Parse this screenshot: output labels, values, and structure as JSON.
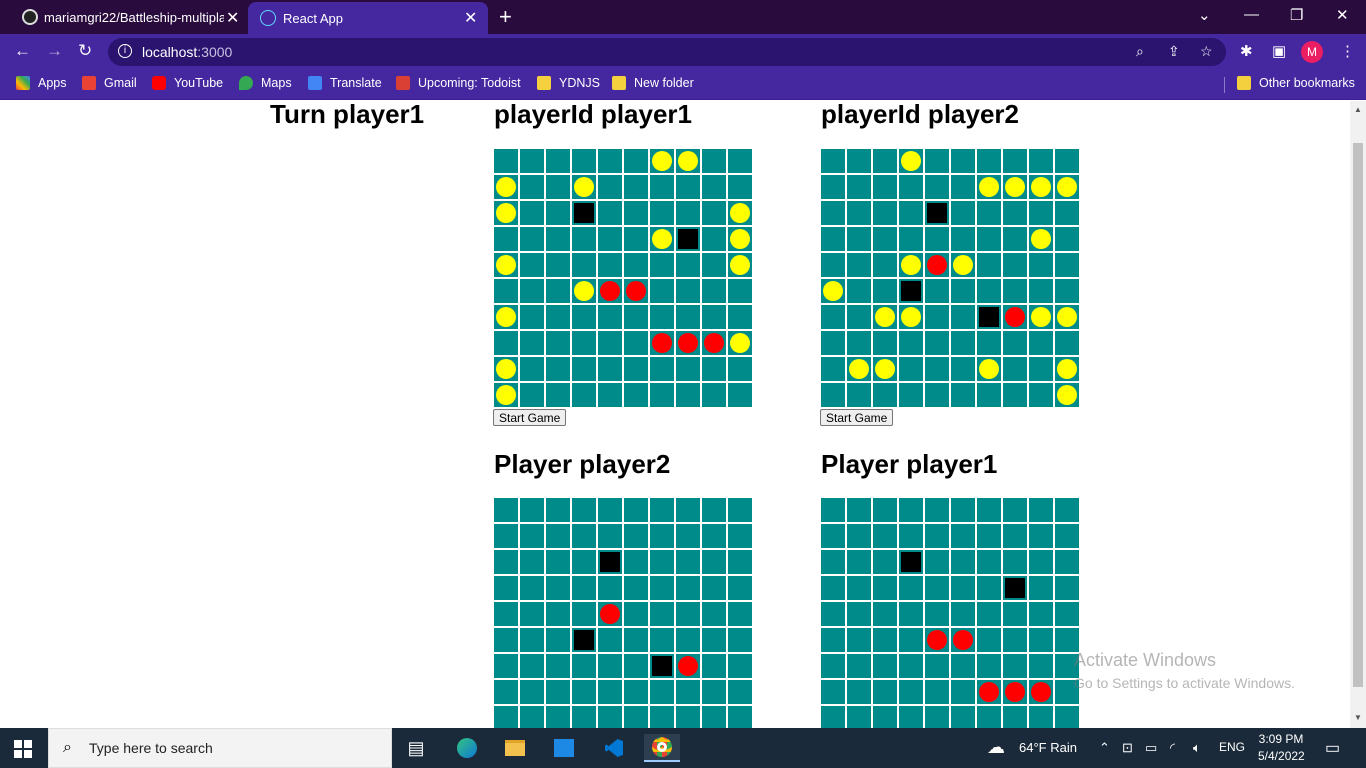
{
  "browser": {
    "tabs": [
      {
        "title": "mariamgri22/Battleship-multipla",
        "favicon": "github-icon"
      },
      {
        "title": "React App",
        "favicon": "react-icon"
      }
    ],
    "url_host": "localhost",
    "url_port": ":3000",
    "profile_initial": "M",
    "bookmarks": [
      {
        "label": "Apps",
        "icon": "apps-grid-icon"
      },
      {
        "label": "Gmail",
        "icon": "gmail-icon"
      },
      {
        "label": "YouTube",
        "icon": "youtube-icon"
      },
      {
        "label": "Maps",
        "icon": "maps-icon"
      },
      {
        "label": "Translate",
        "icon": "translate-icon"
      },
      {
        "label": "Upcoming: Todoist",
        "icon": "todoist-icon"
      },
      {
        "label": "YDNJS",
        "icon": "folder-icon"
      },
      {
        "label": "New folder",
        "icon": "folder-icon"
      }
    ],
    "other_bookmarks": "Other bookmarks"
  },
  "page": {
    "turn_label": "Turn player1",
    "board1_title": "playerId player1",
    "board2_title": "playerId player2",
    "board3_title": "Player player2",
    "board4_title": "Player player1",
    "start_button": "Start Game",
    "colors": {
      "water": "#008b8b",
      "miss": "#ffff00",
      "hit": "#ff0000",
      "ship": "#000000"
    },
    "boards": {
      "board1": [
        "......YY..",
        "Y..Y......",
        "Y..S.....Y",
        "......YS.Y",
        "Y........Y",
        "...YRR....",
        "Y.........",
        "......RRRY",
        "Y.........",
        "Y........."
      ],
      "board2": [
        "...Y......",
        "......YYYY",
        "....S.....",
        "........Y.",
        "...YRY....",
        "Y..S......",
        "..YY..SRYY",
        "..........",
        ".YY...Y..Y",
        ".........Y"
      ],
      "board3": [
        "..........",
        "..........",
        "....S.....",
        "..........",
        "....R.....",
        "...S......",
        "......SR..",
        "..........",
        "..........",
        ".........."
      ],
      "board4": [
        "..........",
        "..........",
        "...S......",
        ".......S..",
        "..........",
        "....RR....",
        "..........",
        "......RRR.",
        "..........",
        ".........."
      ]
    }
  },
  "watermark": {
    "line1": "Activate Windows",
    "line2": "Go to Settings to activate Windows."
  },
  "taskbar": {
    "search_placeholder": "Type here to search",
    "weather": "64°F  Rain",
    "language": "ENG",
    "time": "3:09 PM",
    "date": "5/4/2022"
  }
}
